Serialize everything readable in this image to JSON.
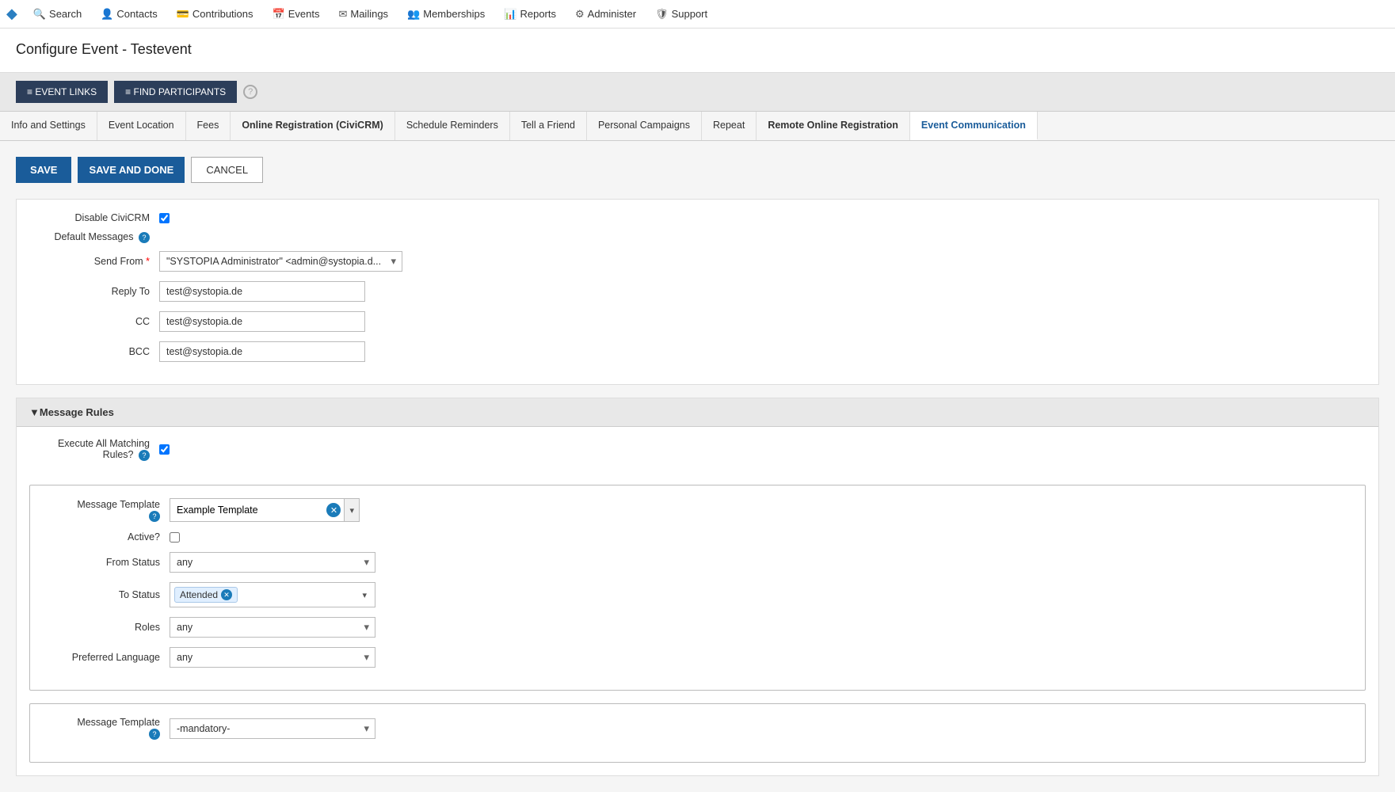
{
  "nav": {
    "logo": "◆",
    "items": [
      {
        "icon": "🔍",
        "label": "Search"
      },
      {
        "icon": "👤",
        "label": "Contacts"
      },
      {
        "icon": "💳",
        "label": "Contributions"
      },
      {
        "icon": "📅",
        "label": "Events"
      },
      {
        "icon": "✉",
        "label": "Mailings"
      },
      {
        "icon": "👥",
        "label": "Memberships"
      },
      {
        "icon": "📊",
        "label": "Reports"
      },
      {
        "icon": "⚙",
        "label": "Administer"
      },
      {
        "icon": "🛡",
        "label": "Support"
      }
    ]
  },
  "page": {
    "title": "Configure Event - Testevent"
  },
  "action_buttons": [
    {
      "label": "≡  EVENT LINKS"
    },
    {
      "label": "≡  FIND PARTICIPANTS"
    }
  ],
  "tabs": [
    {
      "label": "Info and Settings",
      "active": false
    },
    {
      "label": "Event Location",
      "active": false
    },
    {
      "label": "Fees",
      "active": false
    },
    {
      "label": "Online Registration (CiviCRM)",
      "active": false,
      "bold": true
    },
    {
      "label": "Schedule Reminders",
      "active": false
    },
    {
      "label": "Tell a Friend",
      "active": false
    },
    {
      "label": "Personal Campaigns",
      "active": false
    },
    {
      "label": "Repeat",
      "active": false
    },
    {
      "label": "Remote Online Registration",
      "active": false,
      "bold": true
    },
    {
      "label": "Event Communication",
      "active": true
    }
  ],
  "form_actions": {
    "save_label": "SAVE",
    "save_done_label": "SAVE AND DONE",
    "cancel_label": "CANCEL"
  },
  "default_messages": {
    "disable_civcrm_label": "Disable CiviCRM",
    "default_messages_label": "Default Messages",
    "send_from_label": "Send From",
    "send_from_required": true,
    "send_from_value": "\"SYSTOPIA Administrator\" <admin@systopia.d...",
    "reply_to_label": "Reply To",
    "reply_to_value": "test@systopia.de",
    "cc_label": "CC",
    "cc_value": "test@systopia.de",
    "bcc_label": "BCC",
    "bcc_value": "test@systopia.de"
  },
  "message_rules": {
    "header": "Message Rules",
    "execute_all_label": "Execute All Matching",
    "rules_label": "Rules?",
    "execute_checked": true,
    "template_blocks": [
      {
        "template_label": "Message Template",
        "template_value": "Example Template",
        "active_label": "Active?",
        "active_checked": false,
        "from_status_label": "From Status",
        "from_status_value": "any",
        "to_status_label": "To Status",
        "to_status_value": "Attended",
        "roles_label": "Roles",
        "roles_value": "any",
        "preferred_language_label": "Preferred Language",
        "preferred_language_value": "any"
      },
      {
        "template_label": "Message Template",
        "template_value": "-mandatory-",
        "active_label": "",
        "active_checked": false,
        "from_status_label": "",
        "from_status_value": "",
        "to_status_label": "",
        "to_status_value": "",
        "roles_label": "",
        "roles_value": "",
        "preferred_language_label": "",
        "preferred_language_value": ""
      }
    ]
  }
}
